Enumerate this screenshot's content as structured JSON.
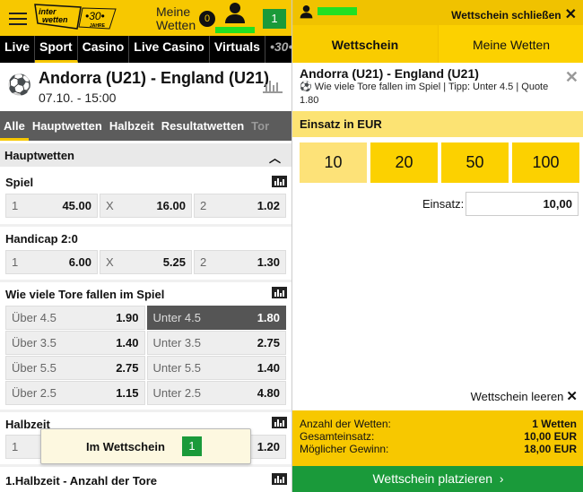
{
  "header": {
    "logo_text": "inter wetten",
    "logo_anniv": "•30•",
    "logo_sub": "JAHRE",
    "meine_wetten": "Meine Wetten",
    "open_bets": "0",
    "slip_count": "1"
  },
  "nav": [
    "Live",
    "Sport",
    "Casino",
    "Live Casino",
    "Virtuals",
    "•30•"
  ],
  "match": {
    "title": "Andorra (U21) - England (U21)",
    "date": "07.10. - 15:00"
  },
  "tabs": [
    "Alle",
    "Hauptwetten",
    "Halbzeit",
    "Resultatwetten",
    "Tor"
  ],
  "section": {
    "title": "Hauptwetten"
  },
  "markets": {
    "spiel": {
      "title": "Spiel",
      "odds": [
        {
          "l": "1",
          "o": "45.00"
        },
        {
          "l": "X",
          "o": "16.00"
        },
        {
          "l": "2",
          "o": "1.02"
        }
      ]
    },
    "handicap": {
      "title": "Handicap 2:0",
      "odds": [
        {
          "l": "1",
          "o": "6.00"
        },
        {
          "l": "X",
          "o": "5.25"
        },
        {
          "l": "2",
          "o": "1.30"
        }
      ]
    },
    "tore": {
      "title": "Wie viele Tore fallen im Spiel",
      "odds": [
        {
          "l": "Über 4.5",
          "o": "1.90"
        },
        {
          "l": "Unter 4.5",
          "o": "1.80"
        },
        {
          "l": "Über 3.5",
          "o": "1.40"
        },
        {
          "l": "Unter 3.5",
          "o": "2.75"
        },
        {
          "l": "Über 5.5",
          "o": "2.75"
        },
        {
          "l": "Unter 5.5",
          "o": "1.40"
        },
        {
          "l": "Über 2.5",
          "o": "1.15"
        },
        {
          "l": "Unter 2.5",
          "o": "4.80"
        }
      ]
    },
    "halbzeit": {
      "title": "Halbzeit",
      "odds": [
        {
          "l": "1",
          "o": ""
        },
        {
          "l": "",
          "o": ""
        },
        {
          "l": "",
          "o": "1.20"
        }
      ]
    },
    "ht_tore": {
      "title": "1.Halbzeit - Anzahl der Tore"
    }
  },
  "popup": {
    "label": "Im Wettschein",
    "count": "1"
  },
  "slip": {
    "close": "Wettschein schließen",
    "tabs": [
      "Wettschein",
      "Meine Wetten"
    ],
    "bet": {
      "title": "Andorra (U21) - England (U21)",
      "detail": "Wie viele Tore fallen im Spiel | Tipp: Unter 4.5 | Quote 1.80"
    },
    "stake_header": "Einsatz in EUR",
    "stakes": [
      "10",
      "20",
      "50",
      "100"
    ],
    "stake_label": "Einsatz:",
    "stake_value": "10,00",
    "clear": "Wettschein leeren",
    "summary": [
      {
        "k": "Anzahl der Wetten:",
        "v": "1 Wetten"
      },
      {
        "k": "Gesamteinsatz:",
        "v": "10,00 EUR"
      },
      {
        "k": "Möglicher Gewinn:",
        "v": "18,00 EUR"
      }
    ],
    "place": "Wettschein platzieren"
  },
  "colors": {
    "brand_yellow": "#f7c800",
    "green": "#1a9a3a",
    "selected_odd": "#555555"
  }
}
